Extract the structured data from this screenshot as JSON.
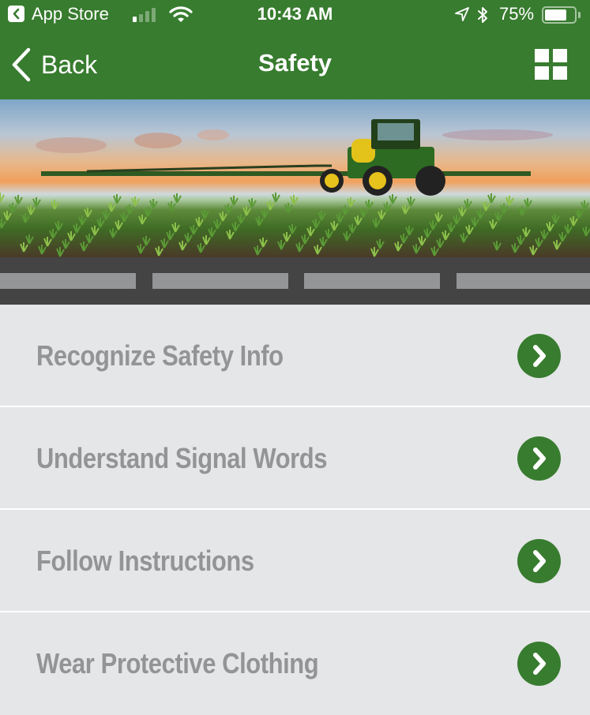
{
  "status_bar": {
    "back_app": "App Store",
    "time": "10:43 AM",
    "battery_percent": "75%",
    "battery_level": 0.75,
    "signal_bars_active": 1,
    "signal_bars_total": 4,
    "icons": [
      "back-to-app-icon",
      "signal-icon",
      "wifi-icon",
      "location-icon",
      "bluetooth-icon",
      "battery-icon"
    ]
  },
  "nav": {
    "back_label": "Back",
    "title": "Safety",
    "menu_icon": "grid-icon"
  },
  "hero": {
    "alt": "Sprayer tractor in corn field at sunset"
  },
  "carousel": {
    "indicator_count": 4
  },
  "list": {
    "items": [
      {
        "label": "Recognize Safety Info",
        "icon": "chevron-right-circle-icon"
      },
      {
        "label": "Understand Signal Words",
        "icon": "chevron-right-circle-icon"
      },
      {
        "label": "Follow Instructions",
        "icon": "chevron-right-circle-icon"
      },
      {
        "label": "Wear Protective Clothing",
        "icon": "chevron-right-circle-icon"
      }
    ]
  },
  "colors": {
    "brand_green": "#387c2f",
    "list_background": "#e5e6e8",
    "list_text": "#939496",
    "band_dark": "#444444",
    "band_segment": "#949597"
  }
}
